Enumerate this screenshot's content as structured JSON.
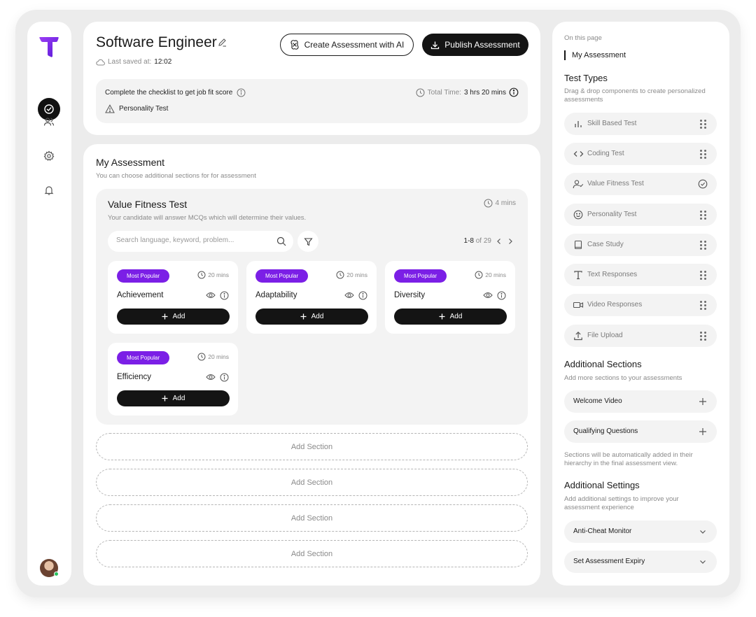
{
  "header": {
    "title": "Software Engineer",
    "last_saved_label": "Last saved at:",
    "last_saved_time": "12:02",
    "create_ai_label": "Create Assessment with AI",
    "publish_label": "Publish Assessment"
  },
  "checklist": {
    "text": "Complete the checklist to get job fit score",
    "total_time_label": "Total Time:",
    "total_time_value": "3 hrs 20 mins",
    "item": "Personality Test"
  },
  "main": {
    "title": "My Assessment",
    "subtitle": "You can choose additional sections for for assessment",
    "section": {
      "title": "Value Fitness Test",
      "subtitle": "Your candidate will answer MCQs which will determine their values.",
      "time": "4 mins",
      "search_placeholder": "Search language, keyword, problem...",
      "pager_range": "1-8",
      "pager_total": "of 29",
      "cards": [
        {
          "badge": "Most Popular",
          "time": "20 mins",
          "name": "Achievement",
          "add": "Add"
        },
        {
          "badge": "Most Popular",
          "time": "20 mins",
          "name": "Adaptability",
          "add": "Add"
        },
        {
          "badge": "Most Popular",
          "time": "20 mins",
          "name": "Diversity",
          "add": "Add"
        },
        {
          "badge": "Most Popular",
          "time": "20 mins",
          "name": "Efficiency",
          "add": "Add"
        }
      ]
    },
    "add_sections": [
      "Add Section",
      "Add Section",
      "Add Section",
      "Add Section"
    ]
  },
  "right": {
    "on_this_page": "On this page",
    "on_this_page_link": "My Assessment",
    "test_types_title": "Test Types",
    "test_types_sub": "Drag & drop components to create personalized assessments",
    "test_types": [
      {
        "label": "Skill Based Test",
        "icon": "bar-chart-icon",
        "state": "drag"
      },
      {
        "label": "Coding Test",
        "icon": "code-icon",
        "state": "drag"
      },
      {
        "label": "Value Fitness Test",
        "icon": "user-check-icon",
        "state": "added"
      },
      {
        "label": "Personality Test",
        "icon": "smile-icon",
        "state": "drag"
      },
      {
        "label": "Case Study",
        "icon": "book-icon",
        "state": "drag"
      },
      {
        "label": "Text Responses",
        "icon": "text-icon",
        "state": "drag"
      },
      {
        "label": "Video Responses",
        "icon": "video-icon",
        "state": "drag"
      },
      {
        "label": "File Upload",
        "icon": "upload-icon",
        "state": "drag"
      }
    ],
    "additional_sections_title": "Additional Sections",
    "additional_sections_sub": "Add more sections to your assessments",
    "additional_sections": [
      "Welcome Video",
      "Qualifying Questions"
    ],
    "additional_sections_note": "Sections will be automatically added in their hierarchy in the final assessment view.",
    "additional_settings_title": "Additional Settings",
    "additional_settings_sub": "Add additional settings to improve your assessment experience",
    "additional_settings": [
      "Anti-Cheat Monitor",
      "Set Assessment Expiry"
    ]
  },
  "colors": {
    "accent": "#7b1fe6",
    "dark": "#141414",
    "panel": "#f3f3f3",
    "frame": "#ececec"
  }
}
